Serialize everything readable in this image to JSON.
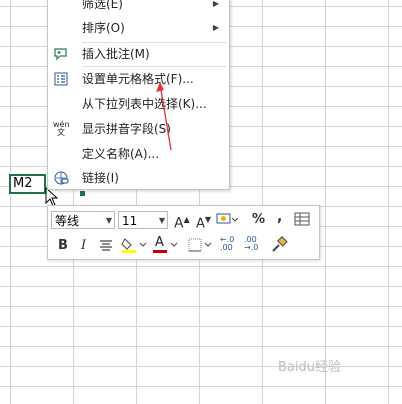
{
  "cell": {
    "reference": "M2"
  },
  "context_menu": {
    "items": [
      {
        "label": "筛选(E)",
        "icon": "",
        "submenu": true
      },
      {
        "label": "排序(O)",
        "icon": "",
        "submenu": true
      },
      {
        "label": "插入批注(M)",
        "icon": "comment-icon",
        "submenu": false
      },
      {
        "label": "设置单元格格式(F)...",
        "icon": "format-cells-icon",
        "submenu": false
      },
      {
        "label": "从下拉列表中选择(K)...",
        "icon": "",
        "submenu": false
      },
      {
        "label": "显示拼音字段(S)",
        "icon": "phonetic-icon",
        "submenu": false
      },
      {
        "label": "定义名称(A)...",
        "icon": "",
        "submenu": false
      },
      {
        "label": "链接(I)",
        "icon": "link-icon",
        "submenu": false
      }
    ]
  },
  "mini_toolbar": {
    "font_name": "等线",
    "font_size": "11",
    "percent": "%",
    "comma": ",",
    "bold": "B",
    "italic": "I",
    "increase_font": "A",
    "decrease_font": "A",
    "font_color_letter": "A",
    "inc_decimal": "←.0\n.00",
    "dec_decimal": ".00\n→.0"
  },
  "phonetic_label": "wén\n文",
  "watermark": "Baidu经验",
  "colors": {
    "accent": "#217346",
    "highlight": "#ffff00",
    "font_color": "#c00000",
    "arrow": "#e0333b"
  }
}
